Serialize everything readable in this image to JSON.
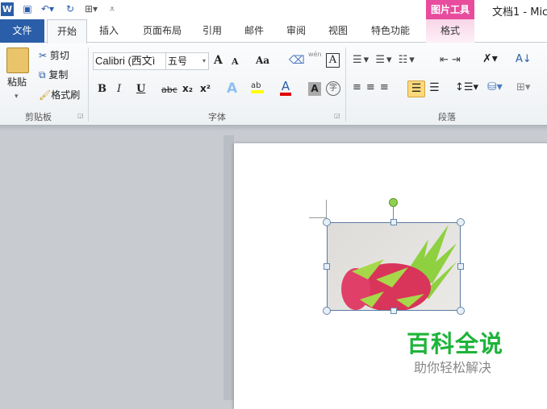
{
  "title_bar": {
    "app_icon": "word-icon",
    "quick_access": [
      "save-icon",
      "undo-icon",
      "redo-icon",
      "print-preview-icon",
      "customize-icon"
    ],
    "contextual_group": "图片工具",
    "title": "文档1 - Mic"
  },
  "tabs": [
    "文件",
    "开始",
    "插入",
    "页面布局",
    "引用",
    "邮件",
    "审阅",
    "视图",
    "特色功能",
    "格式"
  ],
  "clipboard": {
    "paste": "粘贴",
    "cut": "剪切",
    "copy": "复制",
    "format_painter": "格式刷",
    "label": "剪贴板"
  },
  "font": {
    "font_name": "Calibri (西文ì",
    "font_size": "五号",
    "bold": "B",
    "italic": "I",
    "underline": "U",
    "strike": "abc",
    "subscript": "x₂",
    "superscript": "x²",
    "change_case": "Aa",
    "grow": "A",
    "shrink": "A",
    "clear": "A",
    "phonetic": "wén",
    "char_border": "A",
    "highlight": "ab",
    "font_color": "A",
    "shading": "A",
    "enclose": "字",
    "label": "字体"
  },
  "paragraph": {
    "label": "段落"
  },
  "watermark": {
    "title": "百科全说",
    "subtitle": "助你轻松解决"
  },
  "colors": {
    "file_tab": "#2a5ea8",
    "accent_green": "#1db43a",
    "highlight": "#ffff00",
    "font_red": "#e00000"
  }
}
